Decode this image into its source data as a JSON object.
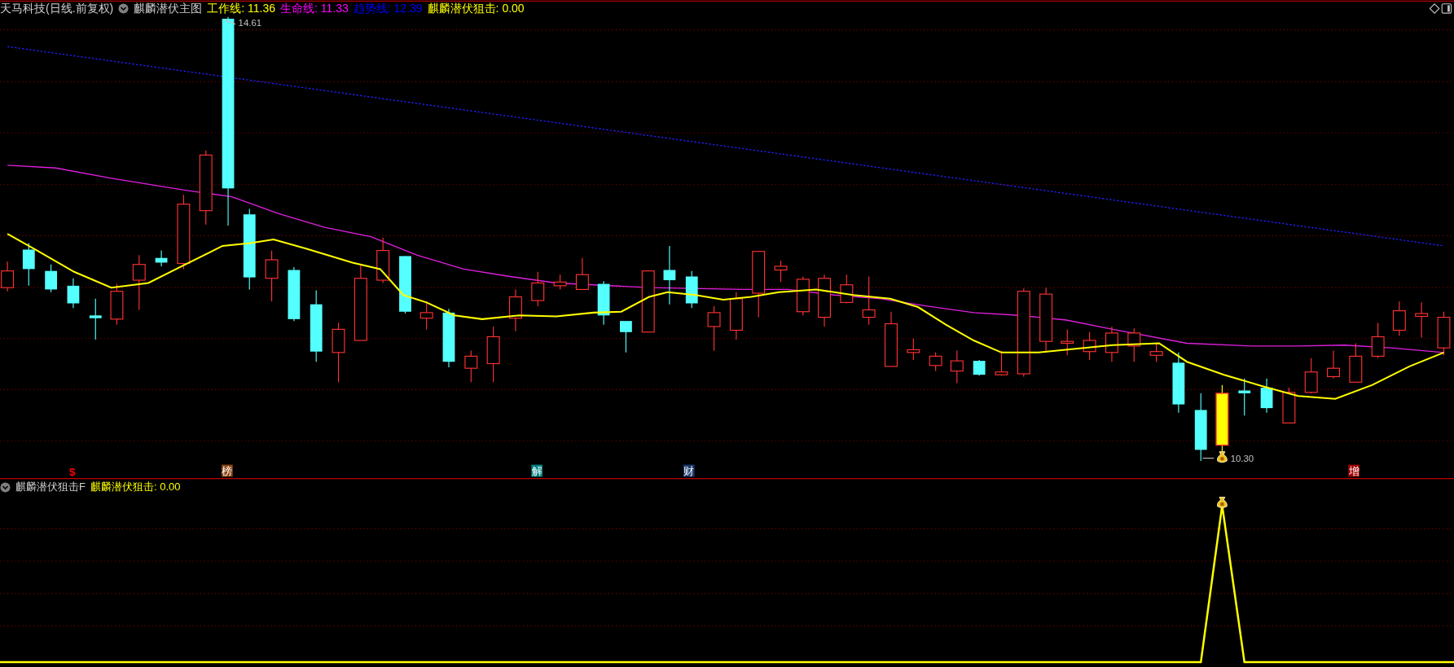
{
  "main_panel": {
    "title": "天马科技(日线.前复权)",
    "indicator_name": "麒麟潜伏主图",
    "indicators": [
      {
        "text": "工作线: 11.36",
        "color": "#ffff00"
      },
      {
        "text": "生命线: 11.33",
        "color": "#ff00ff"
      },
      {
        "text": "趋势线: 12.39",
        "color": "#0000ff"
      },
      {
        "text": "麒麟潜伏狙击: 0.00",
        "color": "#ffff00"
      }
    ],
    "high_label": "14.61",
    "low_label": "10.30",
    "markers": [
      {
        "text": "$",
        "kind": "symbol",
        "color": "#ff0000"
      },
      {
        "text": "榜",
        "kind": "badge",
        "color": "#8b4513"
      },
      {
        "text": "解",
        "kind": "badge",
        "color": "#008080"
      },
      {
        "text": "财",
        "kind": "badge",
        "color": "#1a3a6e"
      },
      {
        "text": "增",
        "kind": "badge",
        "color": "#a00000"
      }
    ]
  },
  "sub_panel": {
    "indicator_name": "麒麟潜伏狙击F",
    "indicators": [
      {
        "text": "麒麟潜伏狙击: 0.00",
        "color": "#ffff00"
      }
    ]
  }
}
